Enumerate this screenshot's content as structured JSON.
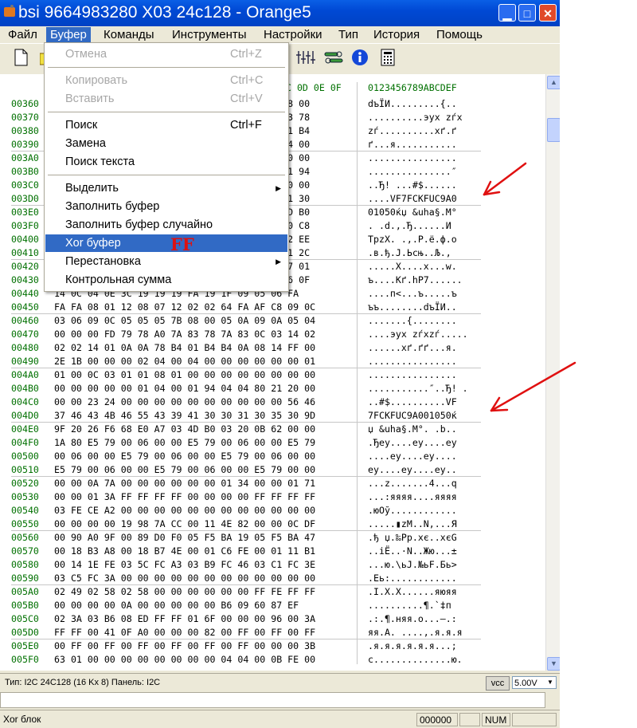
{
  "window": {
    "title": "bsi 9664983280 X03  24c128 - Orange5"
  },
  "menubar": [
    "Файл",
    "Буфер",
    "Команды",
    "Инструменты",
    "Настройки",
    "Тип",
    "История",
    "Помощь"
  ],
  "toolbar": {
    "icons": [
      "new-file-icon",
      "open-file-icon",
      "equalizer-icon",
      "tools-icon",
      "info-icon",
      "calculator-icon"
    ]
  },
  "dropdown": {
    "items": [
      {
        "label": "Отмена",
        "shortcut": "Ctrl+Z",
        "disabled": true
      },
      {
        "label": "Копировать",
        "shortcut": "Ctrl+C",
        "disabled": true
      },
      {
        "label": "Вставить",
        "shortcut": "Ctrl+V",
        "disabled": true
      },
      {
        "label": "Поиск",
        "shortcut": "Ctrl+F"
      },
      {
        "label": "Замена",
        "shortcut": ""
      },
      {
        "label": "Поиск текста",
        "shortcut": ""
      },
      {
        "label": "Выделить",
        "shortcut": "",
        "submenu": true
      },
      {
        "label": "Заполнить буфер",
        "shortcut": ""
      },
      {
        "label": "Заполнить буфер случайно",
        "shortcut": ""
      },
      {
        "label": "Xor буфер",
        "shortcut": "",
        "highlighted": true
      },
      {
        "label": "Перестановка",
        "shortcut": "",
        "submenu": true
      },
      {
        "label": "Контрольная сумма",
        "shortcut": ""
      }
    ]
  },
  "annotation": {
    "text": "FF",
    "color": "#dd1111"
  },
  "hex": {
    "header_hex": "0C 0D 0E 0F",
    "header_ascii": "0123456789ABCDEF",
    "rows": [
      {
        "addr": "00360",
        "hex": "                                    5 7B 08 00",
        "ascii": "dъЇИ.........{.."
      },
      {
        "addr": "00370",
        "hex": "                                    0 7A 83 78",
        "ascii": "..........эух zѓх"
      },
      {
        "addr": "00380",
        "hex": "                                    8 B4 01 B4",
        "ascii": "zѓ..........хґ.ґ"
      },
      {
        "addr": "00390",
        "hex": "                                    4 00 04 00",
        "ascii": "ґ...я..........."
      },
      {
        "addr": "003A0",
        "hex": "                                    8 01 00 00",
        "ascii": "................"
      },
      {
        "addr": "003B0",
        "hex": "                                    4 00 01 94",
        "ascii": "...............″"
      },
      {
        "addr": "003C0",
        "hex": "                                    0 00 00 00",
        "ascii": "..Ђ! ...#$......"
      },
      {
        "addr": "003D0",
        "hex": "                                    3 39 41 30",
        "ascii": "....VF7FCKFUC9A0"
      },
      {
        "addr": "003E0",
        "hex": "                                    7 03 4D B0",
        "ascii": "01050ќџ &uha§.M°"
      },
      {
        "addr": "003F0",
        "hex": "                                    0 0A 00 C8",
        "ascii": ". .d.,.Ђ......И"
      },
      {
        "addr": "00400",
        "hex": "                                    1 F4 02 EE",
        "ascii": "TpzX. .,.P.ё.ф.о"
      },
      {
        "addr": "00410",
        "hex": "                                    2 8A 01 2C",
        "ascii": ".в.ђ.J.Ьсњ..Љ.,"
      },
      {
        "addr": "00420",
        "hex": "                                    5 03 77 01",
        "ascii": ".....X....х...w."
      },
      {
        "addr": "00430",
        "hex": "                                    6 03 06 0F",
        "ascii": "ъ....Kґ.hР7......"
      },
      {
        "addr": "00440",
        "hex": "14 0C 04 0E 3C 19 19 19 FA 19 1F 09 05 06 FA",
        "ascii": "....п<...ъ.....ъ"
      },
      {
        "addr": "00450",
        "hex": "FA FA 08 01 12 08 07 12 02 02 64 FA AF C8 09 0C",
        "ascii": "ъъ........dъЇИ.."
      },
      {
        "addr": "00460",
        "hex": "03 06 09 0C 05 05 05 7B 08 00 05 0A 09 0A 05 04",
        "ascii": ".......{........"
      },
      {
        "addr": "00470",
        "hex": "00 00 00 FD 79 78 A0 7A 83 78 7A 83 0C 03 14 02",
        "ascii": "....эух zѓхzѓ....."
      },
      {
        "addr": "00480",
        "hex": "02 02 14 01 0A 0A 78 B4 01 B4 B4 0A 08 14 FF 00",
        "ascii": "......хґ.ґґ...я."
      },
      {
        "addr": "00490",
        "hex": "2E 1B 00 00 00 02 04 00 04 00 00 00 00 00 00 01",
        "ascii": "................"
      },
      {
        "addr": "004A0",
        "hex": "01 00 0C 03 01 01 08 01 00 00 00 00 00 00 00 00",
        "ascii": "................"
      },
      {
        "addr": "004B0",
        "hex": "00 00 00 00 00 01 04 00 01 94 04 04 80 21 20 00",
        "ascii": "...........″..Ђ! ."
      },
      {
        "addr": "004C0",
        "hex": "00 00 23 24 00 00 00 00 00 00 00 00 00 00 56 46",
        "ascii": "..#$..........VF"
      },
      {
        "addr": "004D0",
        "hex": "37 46 43 4B 46 55 43 39 41 30 30 31 30 35 30 9D",
        "ascii": "7FCKFUC9A001050ќ"
      },
      {
        "addr": "004E0",
        "hex": "9F 20 26 F6 68 E0 A7 03 4D B0 03 20 0B 62 00 00",
        "ascii": "џ &uha§.M°. .b.."
      },
      {
        "addr": "004F0",
        "hex": "1A 80 E5 79 00 06 00 00 E5 79 00 06 00 00 E5 79",
        "ascii": ".Ђеу....еу....еу"
      },
      {
        "addr": "00500",
        "hex": "00 06 00 00 E5 79 00 06 00 00 E5 79 00 06 00 00",
        "ascii": "....еу....еу...."
      },
      {
        "addr": "00510",
        "hex": "E5 79 00 06 00 00 E5 79 00 06 00 00 E5 79 00 00",
        "ascii": "еу....еу....еу.."
      },
      {
        "addr": "00520",
        "hex": "00 00 0A 7A 00 00 00 00 00 00 01 34 00 00 01 71",
        "ascii": "...z.......4...q"
      },
      {
        "addr": "00530",
        "hex": "00 00 01 3A FF FF FF FF 00 00 00 00 FF FF FF FF",
        "ascii": "...:яяяя....яяяя"
      },
      {
        "addr": "00540",
        "hex": "03 FE CE A2 00 00 00 00 00 00 00 00 00 00 00 00",
        "ascii": ".юОў............"
      },
      {
        "addr": "00550",
        "hex": "00 00 00 00 19 98 7A CC 00 11 4E 82 00 00 0C DF",
        "ascii": ".....▮zМ..N,...Я"
      },
      {
        "addr": "00560",
        "hex": "00 90 A0 9F 00 89 D0 F0 05 F5 BA 19 05 F5 BA 47",
        "ascii": ".ђ џ.‰Рр.хє..хєG"
      },
      {
        "addr": "00570",
        "hex": "00 18 B3 A8 00 18 B7 4E 00 01 C6 FE 00 01 11 B1",
        "ascii": "..іЁ..·N..Жю...±"
      },
      {
        "addr": "00580",
        "hex": "00 14 1E FE 03 5C FC A3 03 B9 FC 46 03 C1 FC 3E",
        "ascii": "...ю.\\ьЈ.№ьF.Бь>"
      },
      {
        "addr": "00590",
        "hex": "03 C5 FC 3A 00 00 00 00 00 00 00 00 00 00 00 00",
        "ascii": ".Еь:............"
      },
      {
        "addr": "005A0",
        "hex": "02 49 02 58 02 58 00 00 00 00 00 00 FF FE FF FF",
        "ascii": ".I.X.X......яюяя"
      },
      {
        "addr": "005B0",
        "hex": "00 00 00 00 0A 00 00 00 00 00 B6 09 60 87 EF",
        "ascii": "..........¶.`‡п"
      },
      {
        "addr": "005C0",
        "hex": "02 3A 03 B6 08 ED FF FF 01 6F 00 00 00 96 00 3A",
        "ascii": ".:.¶.няя.o...–.:"
      },
      {
        "addr": "005D0",
        "hex": "FF FF 00 41 0F A0 00 00 00 82 00 FF 00 FF 00 FF",
        "ascii": "яя.A. ....,.я.я.я"
      },
      {
        "addr": "005E0",
        "hex": "00 FF 00 FF 00 FF 00 FF 00 FF 00 FF 00 00 00 3B",
        "ascii": ".я.я.я.я.я.я...;"
      },
      {
        "addr": "005F0",
        "hex": "63 01 00 00 00 00 00 00 00 00 04 04 00 0B FE 00",
        "ascii": "c..............ю."
      }
    ]
  },
  "statusbar": {
    "type_label": "Тип: I2C 24C128 (16 Kx 8)   Панель: I2C",
    "vcc_button": "vcc",
    "voltage": "5.00V",
    "message": "Xor блок",
    "offset": "000000",
    "num": "NUM"
  }
}
